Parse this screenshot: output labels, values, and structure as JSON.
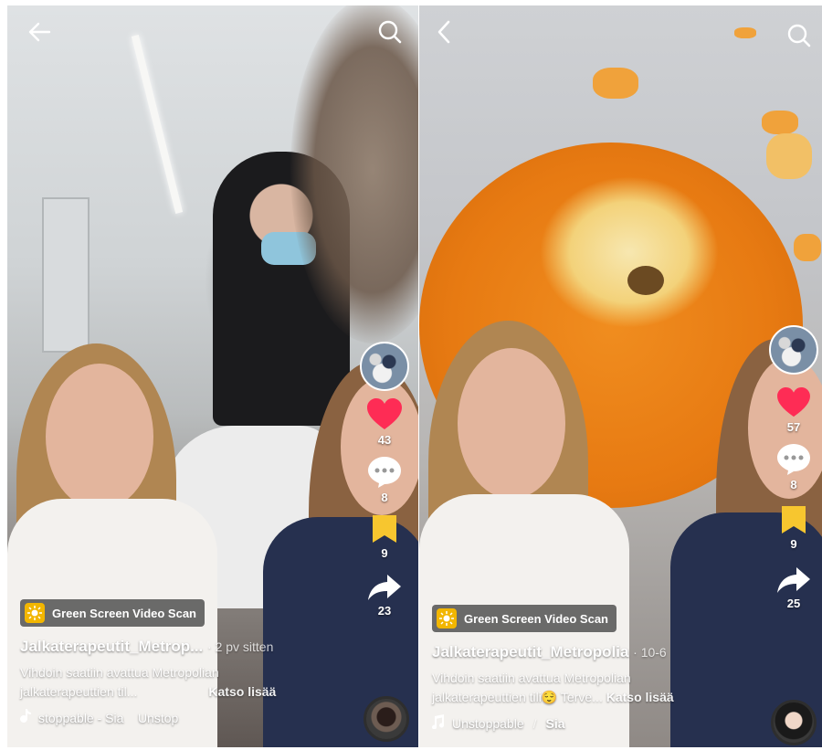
{
  "left_video": {
    "effect_tag": "Green Screen Video Scan",
    "username": "Jalkaterapeutit_Metrop...",
    "date": "· 2 pv sitten",
    "description_line1": "Vihdoin saatiin avattua Metropolian",
    "description_line2": "jalkaterapeuttien til...",
    "see_more": "Katso lisää",
    "music": "stoppable - Sia    Unstop",
    "likes": "43",
    "comments": "8",
    "saves": "9",
    "shares": "23"
  },
  "right_video": {
    "effect_tag": "Green Screen Video Scan",
    "username": "Jalkaterapeutit_Metropolia",
    "date": "· 10-6",
    "description_line1": "Vihdoin saatiin avattua Metropolian",
    "description_line2": "jalkaterapeuttien tili",
    "description_line2_suffix": " Terve...",
    "emoji": "😌",
    "see_more": "Katso lisää",
    "music_title": "Unstoppable",
    "music_artist": "Sia",
    "likes": "57",
    "comments": "8",
    "saves": "9",
    "shares": "25"
  },
  "colors": {
    "like_red": "#fe2c55",
    "save_yellow": "#f7c62f",
    "effect_yellow": "#f2b600"
  }
}
